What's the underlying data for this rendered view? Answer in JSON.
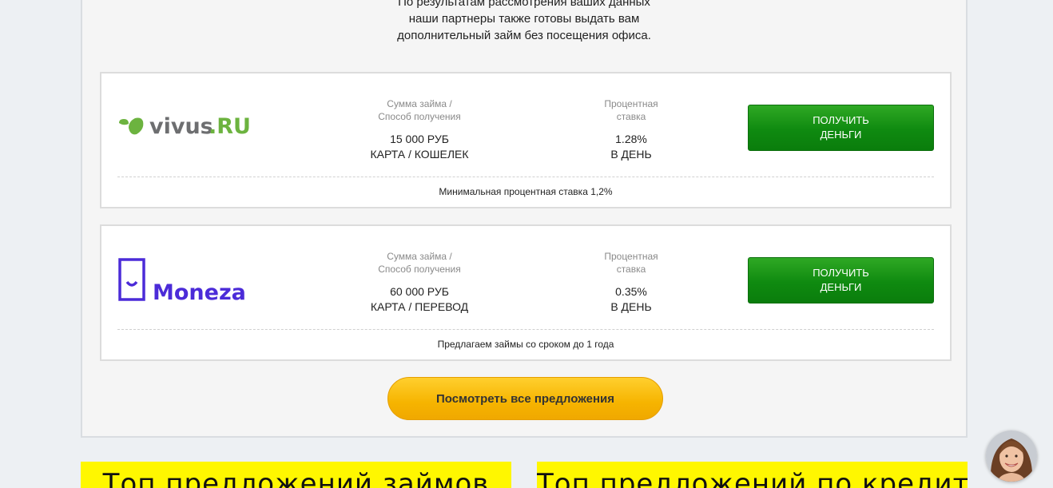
{
  "intro": {
    "line1": "По результатам рассмотрения ваших данных",
    "line2": "наши партнеры также готовы выдать вам",
    "line3": "дополнительный займ без посещения офиса."
  },
  "offers": [
    {
      "logo_text": "vivus.RU",
      "sum_label_1": "Сумма займа /",
      "sum_label_2": "Способ получения",
      "sum_value": "15 000 РУБ",
      "method_value": "КАРТА / КОШЕЛЕК",
      "rate_label_1": "Процентная",
      "rate_label_2": "ставка",
      "rate_value": "1.28%",
      "rate_period": "В ДЕНЬ",
      "button_line1": "ПОЛУЧИТЬ",
      "button_line2": "ДЕНЬГИ",
      "note": "Минимальная процентная ставка 1,2%"
    },
    {
      "logo_text": "Moneza",
      "sum_label_1": "Сумма займа /",
      "sum_label_2": "Способ получения",
      "sum_value": "60 000 РУБ",
      "method_value": "КАРТА / ПЕРЕВОД",
      "rate_label_1": "Процентная",
      "rate_label_2": "ставка",
      "rate_value": "0.35%",
      "rate_period": "В ДЕНЬ",
      "button_line1": "ПОЛУЧИТЬ",
      "button_line2": "ДЕНЬГИ",
      "note": "Предлагаем займы со сроком до 1 года"
    }
  ],
  "all_offers_button": "Посмотреть все предложения",
  "banners": {
    "left": "Топ предложений займов",
    "right": "Топ предложений по кредитам"
  },
  "colors": {
    "vivus_green": "#6cb33f",
    "vivus_gray": "#6d6e70",
    "moneza_purple": "#4b2bd8",
    "button_green": "#0f8a10",
    "cta_yellow": "#f6b400",
    "banner_yellow": "#fff700"
  }
}
